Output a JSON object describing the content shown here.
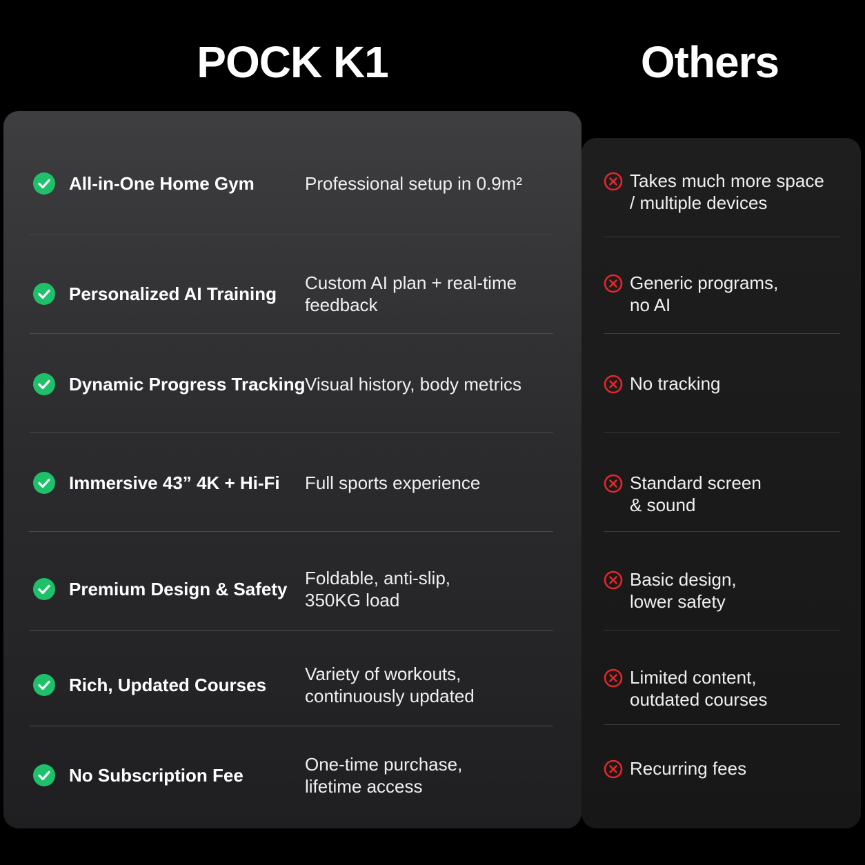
{
  "headers": {
    "product": "POCK K1",
    "others": "Others"
  },
  "colors": {
    "check": "#1fc06a",
    "cross": "#e5262b"
  },
  "rows": [
    {
      "feature": "All-in-One Home Gym",
      "pock": "Professional setup in 0.9m²",
      "others": "Takes much more space\n/ multiple devices"
    },
    {
      "feature": "Personalized AI Training",
      "pock": "Custom AI plan + real-time\nfeedback",
      "others": "Generic programs,\nno AI"
    },
    {
      "feature": "Dynamic Progress Tracking",
      "pock": "Visual history, body metrics",
      "others": "No tracking"
    },
    {
      "feature": "Immersive 43” 4K + Hi-Fi",
      "pock": "Full sports experience",
      "others": "Standard screen\n& sound"
    },
    {
      "feature": "Premium Design & Safety",
      "pock": "Foldable, anti-slip,\n350KG load",
      "others": "Basic design,\nlower safety"
    },
    {
      "feature": "Rich, Updated Courses",
      "pock": "Variety of workouts,\ncontinuously updated",
      "others": "Limited content,\noutdated courses"
    },
    {
      "feature": "No Subscription Fee",
      "pock": "One-time purchase,\nlifetime access",
      "others": "Recurring fees"
    }
  ]
}
